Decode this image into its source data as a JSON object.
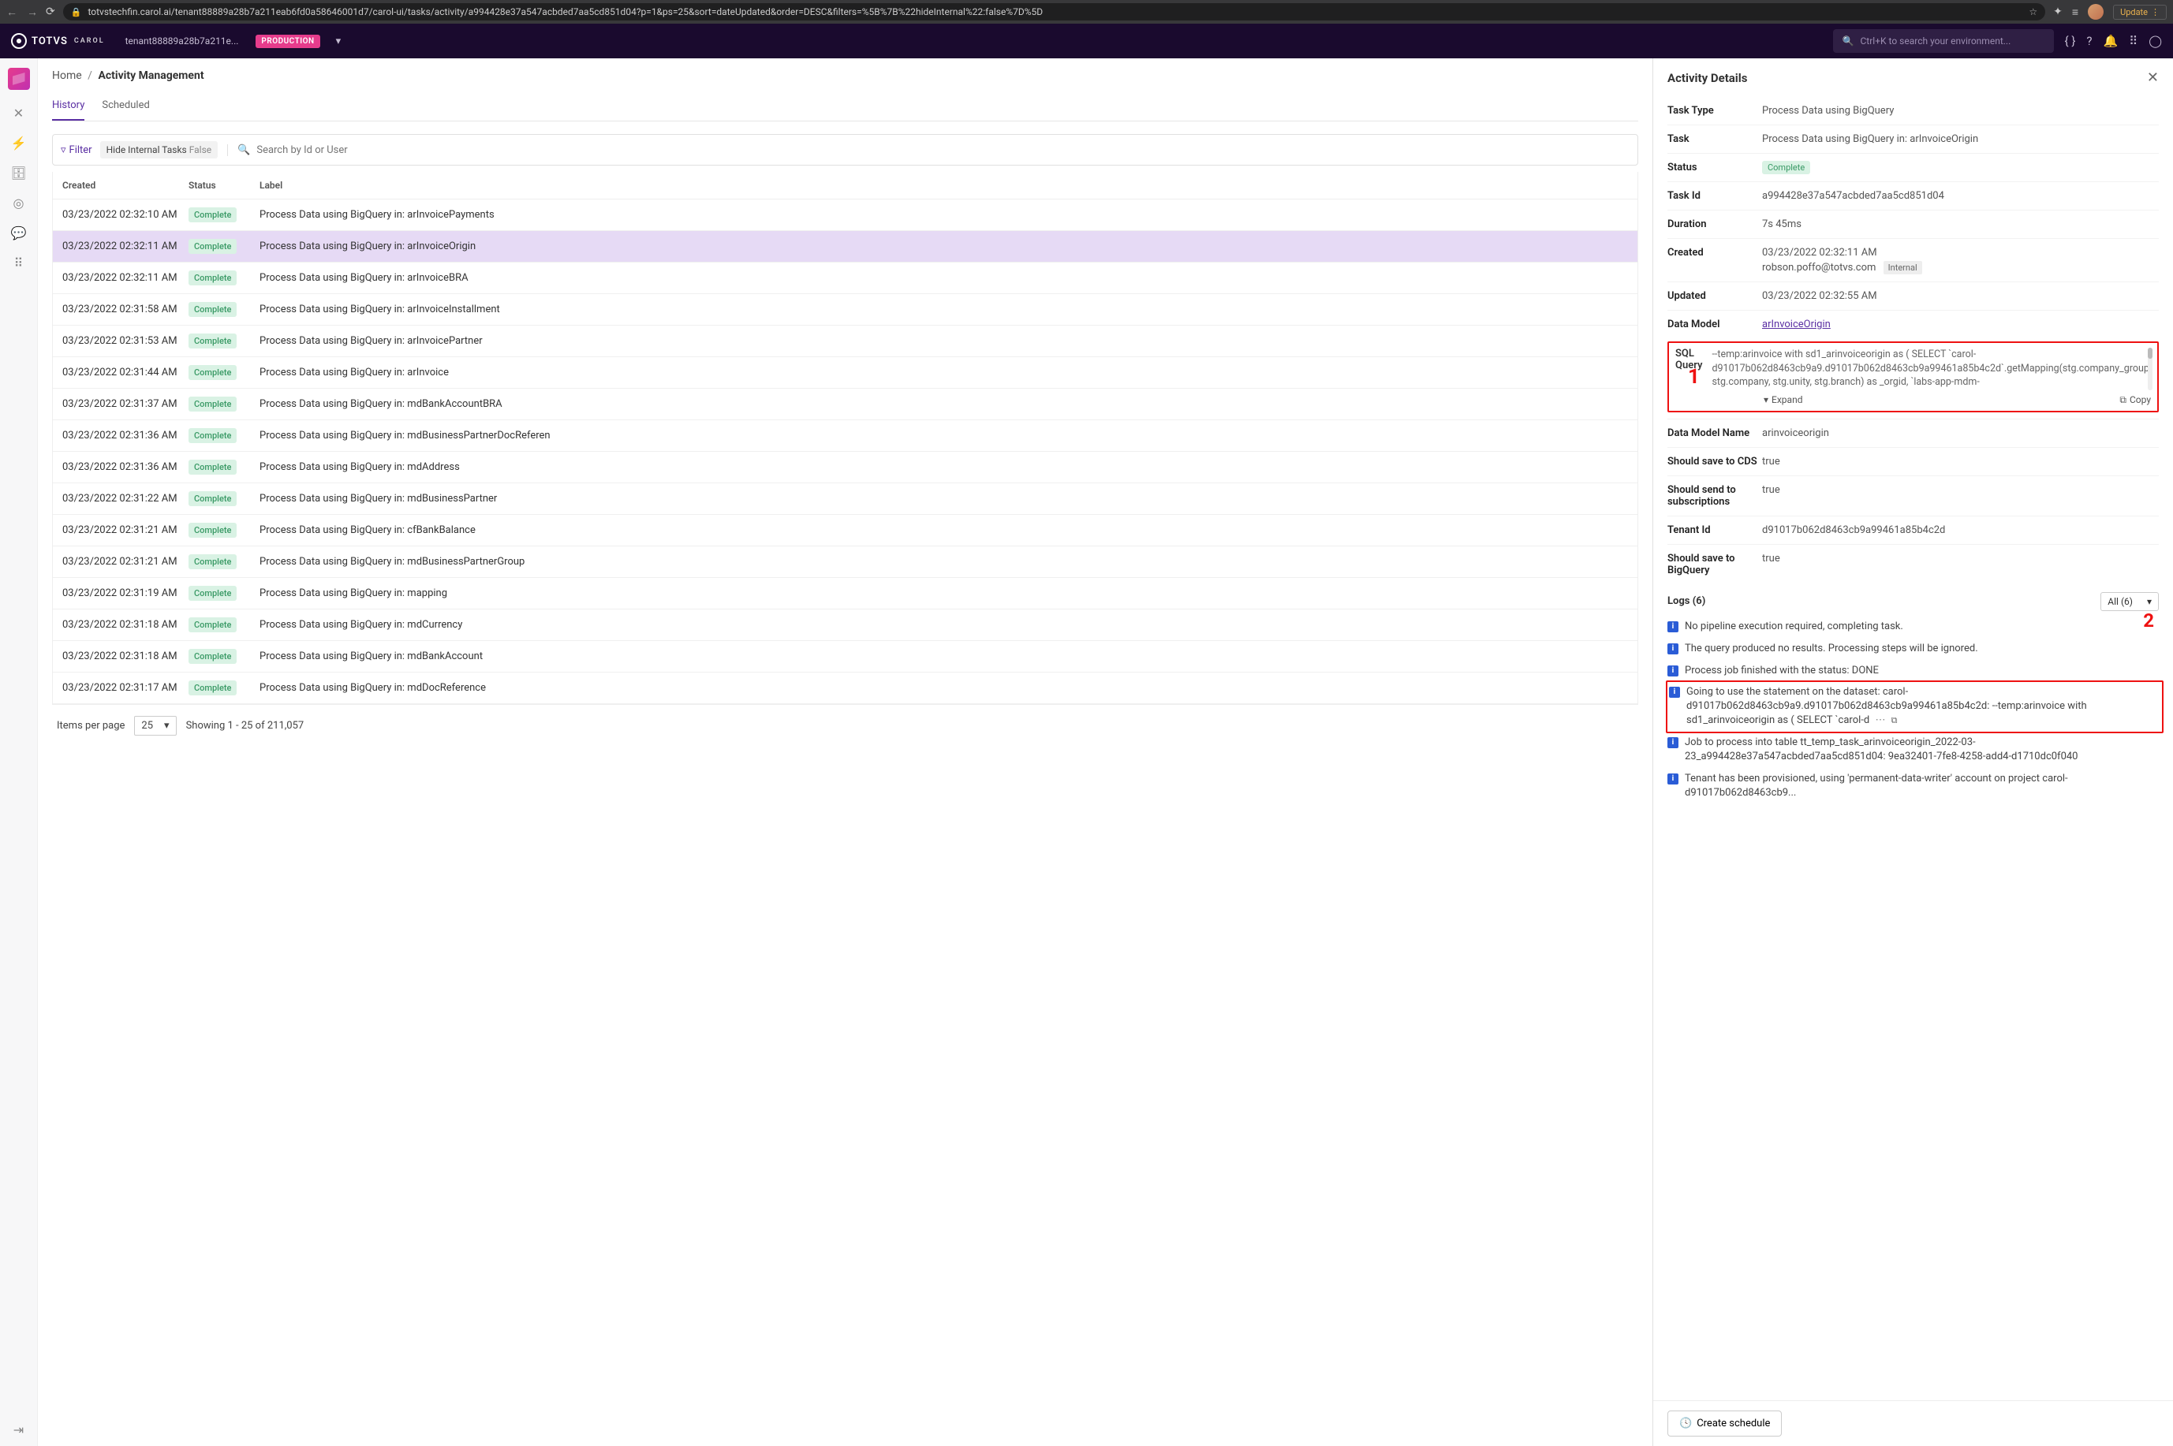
{
  "browser": {
    "url": "totvstechfin.carol.ai/tenant88889a28b7a211eab6fd0a58646001d7/carol-ui/tasks/activity/a994428e37a547acbded7aa5cd851d04?p=1&ps=25&sort=dateUpdated&order=DESC&filters=%5B%7B%22hideInternal%22:false%7D%5D",
    "update_btn": "Update"
  },
  "top": {
    "brand": "TOTVS",
    "brand_sub": "CAROL",
    "tenant": "tenant88889a28b7a211e...",
    "env_badge": "PRODUCTION",
    "search_placeholder": "Ctrl+K to search your environment..."
  },
  "page": {
    "home": "Home",
    "title": "Activity Management",
    "tabs": {
      "history": "History",
      "scheduled": "Scheduled"
    }
  },
  "filter": {
    "btn": "Filter",
    "hide_internal_label": "Hide Internal Tasks",
    "hide_internal_value": "False",
    "search_placeholder": "Search by Id or User"
  },
  "tableHead": {
    "created": "Created",
    "status": "Status",
    "label": "Label"
  },
  "rows": [
    {
      "created": "03/23/2022 02:32:10 AM",
      "status": "Complete",
      "label": "Process Data using BigQuery in: arInvoicePayments"
    },
    {
      "created": "03/23/2022 02:32:11 AM",
      "status": "Complete",
      "label": "Process Data using BigQuery in: arInvoiceOrigin",
      "selected": true
    },
    {
      "created": "03/23/2022 02:32:11 AM",
      "status": "Complete",
      "label": "Process Data using BigQuery in: arInvoiceBRA"
    },
    {
      "created": "03/23/2022 02:31:58 AM",
      "status": "Complete",
      "label": "Process Data using BigQuery in: arInvoiceInstallment"
    },
    {
      "created": "03/23/2022 02:31:53 AM",
      "status": "Complete",
      "label": "Process Data using BigQuery in: arInvoicePartner"
    },
    {
      "created": "03/23/2022 02:31:44 AM",
      "status": "Complete",
      "label": "Process Data using BigQuery in: arInvoice"
    },
    {
      "created": "03/23/2022 02:31:37 AM",
      "status": "Complete",
      "label": "Process Data using BigQuery in: mdBankAccountBRA"
    },
    {
      "created": "03/23/2022 02:31:36 AM",
      "status": "Complete",
      "label": "Process Data using BigQuery in: mdBusinessPartnerDocReferen"
    },
    {
      "created": "03/23/2022 02:31:36 AM",
      "status": "Complete",
      "label": "Process Data using BigQuery in: mdAddress"
    },
    {
      "created": "03/23/2022 02:31:22 AM",
      "status": "Complete",
      "label": "Process Data using BigQuery in: mdBusinessPartner"
    },
    {
      "created": "03/23/2022 02:31:21 AM",
      "status": "Complete",
      "label": "Process Data using BigQuery in: cfBankBalance"
    },
    {
      "created": "03/23/2022 02:31:21 AM",
      "status": "Complete",
      "label": "Process Data using BigQuery in: mdBusinessPartnerGroup"
    },
    {
      "created": "03/23/2022 02:31:19 AM",
      "status": "Complete",
      "label": "Process Data using BigQuery in: mapping"
    },
    {
      "created": "03/23/2022 02:31:18 AM",
      "status": "Complete",
      "label": "Process Data using BigQuery in: mdCurrency"
    },
    {
      "created": "03/23/2022 02:31:18 AM",
      "status": "Complete",
      "label": "Process Data using BigQuery in: mdBankAccount"
    },
    {
      "created": "03/23/2022 02:31:17 AM",
      "status": "Complete",
      "label": "Process Data using BigQuery in: mdDocReference"
    }
  ],
  "foot": {
    "items_per_page": "Items per page",
    "per_page_value": "25",
    "showing": "Showing 1 - 25 of 211,057"
  },
  "details": {
    "title": "Activity Details",
    "fields": {
      "taskType": {
        "k": "Task Type",
        "v": "Process Data using BigQuery"
      },
      "task": {
        "k": "Task",
        "v": "Process Data using BigQuery in: arInvoiceOrigin"
      },
      "status": {
        "k": "Status",
        "v": "Complete"
      },
      "taskId": {
        "k": "Task Id",
        "v": "a994428e37a547acbded7aa5cd851d04"
      },
      "duration": {
        "k": "Duration",
        "v": "7s 45ms"
      },
      "created": {
        "k": "Created",
        "v": "03/23/2022 02:32:11 AM",
        "v2": "robson.poffo@totvs.com",
        "tag": "Internal"
      },
      "updated": {
        "k": "Updated",
        "v": "03/23/2022 02:32:55 AM"
      },
      "dataModel": {
        "k": "Data Model",
        "v": "arInvoiceOrigin"
      },
      "sql": {
        "k": "SQL Query",
        "v": "--temp:arinvoice with sd1_arinvoiceorigin as ( SELECT `carol-d91017b062d8463cb9a9.d91017b062d8463cb9a99461a85b4c2d`.getMapping(stg.company_group, stg.company, stg.unity, stg.branch) as _orgid, `labs-app-mdm-",
        "expand": "Expand",
        "copy": "Copy"
      },
      "dmName": {
        "k": "Data Model Name",
        "v": "arinvoiceorigin"
      },
      "saveCDS": {
        "k": "Should save to CDS",
        "v": "true"
      },
      "sendSubs": {
        "k": "Should send to subscriptions",
        "v": "true"
      },
      "tenantId": {
        "k": "Tenant Id",
        "v": "d91017b062d8463cb9a99461a85b4c2d"
      },
      "saveBQ": {
        "k": "Should save to BigQuery",
        "v": "true"
      }
    },
    "logs": {
      "title": "Logs (6)",
      "filter": "All (6)",
      "items": [
        "No pipeline execution required, completing task.",
        "The query produced no results. Processing steps will be ignored.",
        "Process job finished with the status: DONE",
        "Going to use the statement on the dataset: carol-d91017b062d8463cb9a9.d91017b062d8463cb9a99461a85b4c2d: --temp:arinvoice with sd1_arinvoiceorigin as ( SELECT `carol-d",
        "Job to process into table tt_temp_task_arinvoiceorigin_2022-03-23_a994428e37a547acbded7aa5cd851d04: 9ea32401-7fe8-4258-add4-d1710dc0f040",
        "Tenant has been provisioned, using 'permanent-data-writer' account on project carol-d91017b062d8463cb9..."
      ]
    },
    "create_schedule": "Create schedule"
  },
  "annot": {
    "one": "1",
    "two": "2"
  }
}
